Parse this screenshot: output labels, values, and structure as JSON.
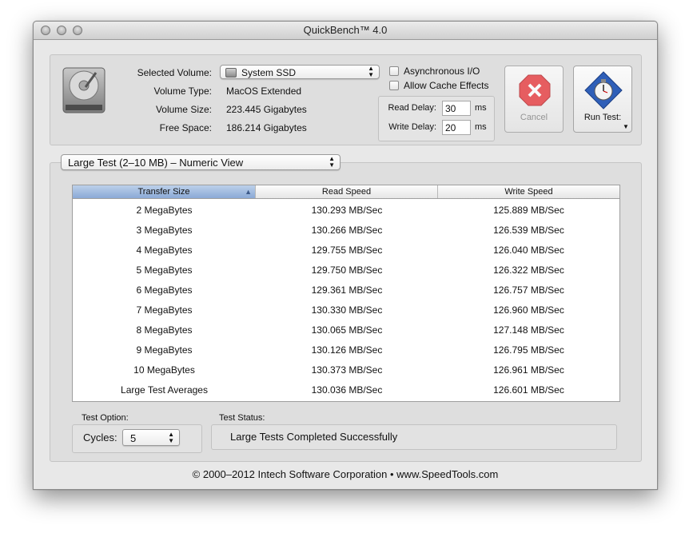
{
  "window": {
    "title": "QuickBench™ 4.0"
  },
  "volume": {
    "selected_label": "Selected Volume:",
    "selected_value": "System SSD",
    "type_label": "Volume Type:",
    "type_value": "MacOS Extended",
    "size_label": "Volume Size:",
    "size_value": "223.445 Gigabytes",
    "free_label": "Free Space:",
    "free_value": "186.214 Gigabytes"
  },
  "options": {
    "async_label": "Asynchronous I/O",
    "async_checked": false,
    "cache_label": "Allow Cache Effects",
    "cache_checked": false,
    "read_delay_label": "Read Delay:",
    "read_delay_value": "30",
    "read_delay_unit": "ms",
    "write_delay_label": "Write Delay:",
    "write_delay_value": "20",
    "write_delay_unit": "ms"
  },
  "buttons": {
    "cancel_label": "Cancel",
    "run_label": "Run Test:"
  },
  "view_selector": {
    "value": "Large Test (2–10 MB) – Numeric View"
  },
  "table": {
    "columns": [
      "Transfer Size",
      "Read Speed",
      "Write Speed"
    ],
    "rows": [
      [
        "2 MegaBytes",
        "130.293 MB/Sec",
        "125.889 MB/Sec"
      ],
      [
        "3 MegaBytes",
        "130.266 MB/Sec",
        "126.539 MB/Sec"
      ],
      [
        "4 MegaBytes",
        "129.755 MB/Sec",
        "126.040 MB/Sec"
      ],
      [
        "5 MegaBytes",
        "129.750 MB/Sec",
        "126.322 MB/Sec"
      ],
      [
        "6 MegaBytes",
        "129.361 MB/Sec",
        "126.757 MB/Sec"
      ],
      [
        "7 MegaBytes",
        "130.330 MB/Sec",
        "126.960 MB/Sec"
      ],
      [
        "8 MegaBytes",
        "130.065 MB/Sec",
        "127.148 MB/Sec"
      ],
      [
        "9 MegaBytes",
        "130.126 MB/Sec",
        "126.795 MB/Sec"
      ],
      [
        "10 MegaBytes",
        "130.373 MB/Sec",
        "126.961 MB/Sec"
      ],
      [
        "Large Test Averages",
        "130.036 MB/Sec",
        "126.601 MB/Sec"
      ]
    ]
  },
  "test_option": {
    "label": "Test Option:",
    "cycles_label": "Cycles:",
    "cycles_value": "5"
  },
  "test_status": {
    "label": "Test Status:",
    "value": "Large Tests Completed Successfully"
  },
  "footer": {
    "copyright": "© 2000–2012 Intech Software Corporation • www.SpeedTools.com"
  },
  "colors": {
    "cancel_red": "#e8474b",
    "run_blue": "#2f5fb8",
    "selected_header": "#9cb6dd"
  }
}
